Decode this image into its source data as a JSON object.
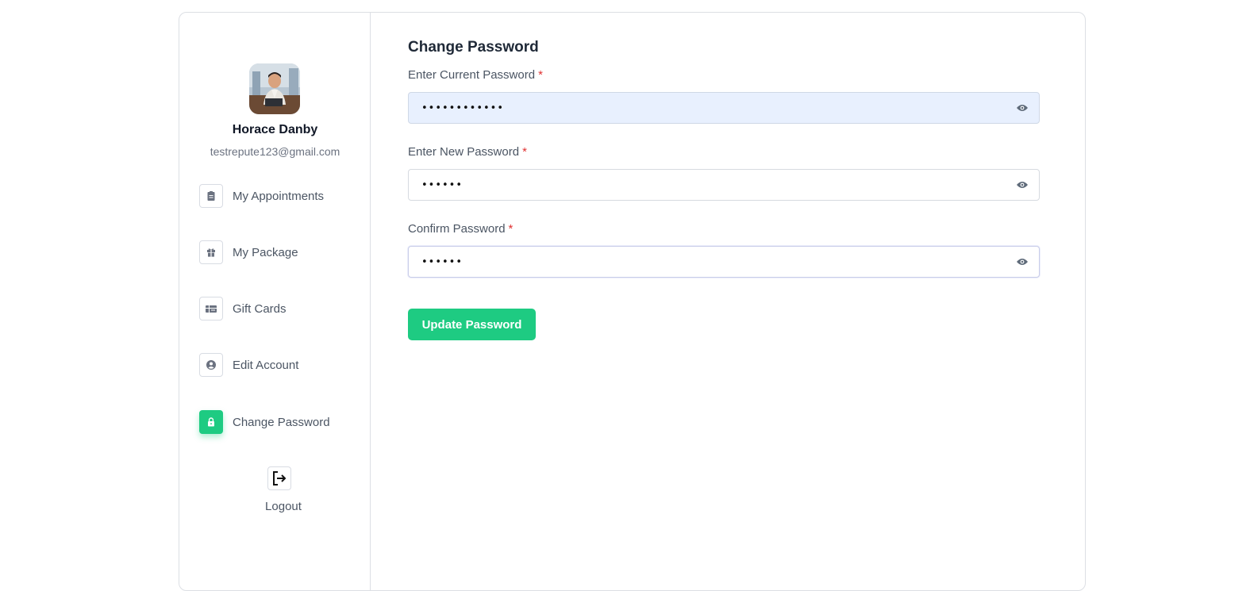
{
  "user": {
    "name": "Horace Danby",
    "email": "testrepute123@gmail.com"
  },
  "sidebar": {
    "items": [
      {
        "label": "My Appointments",
        "icon": "clipboard-icon",
        "active": false
      },
      {
        "label": "My Package",
        "icon": "gift-icon",
        "active": false
      },
      {
        "label": "Gift Cards",
        "icon": "gift-card-icon",
        "active": false
      },
      {
        "label": "Edit Account",
        "icon": "user-circle-icon",
        "active": false
      },
      {
        "label": "Change Password",
        "icon": "lock-icon",
        "active": true
      }
    ],
    "logout_label": "Logout"
  },
  "form": {
    "title": "Change Password",
    "current": {
      "label": "Enter Current Password",
      "value": "••••••••••••"
    },
    "new": {
      "label": "Enter New Password",
      "value": "••••••"
    },
    "confirm": {
      "label": "Confirm Password",
      "value": "••••••"
    },
    "required_mark": "*",
    "submit_label": "Update Password"
  },
  "colors": {
    "accent": "#1ecb82",
    "required": "#e03131",
    "autofill_bg": "#e8f0fe"
  }
}
